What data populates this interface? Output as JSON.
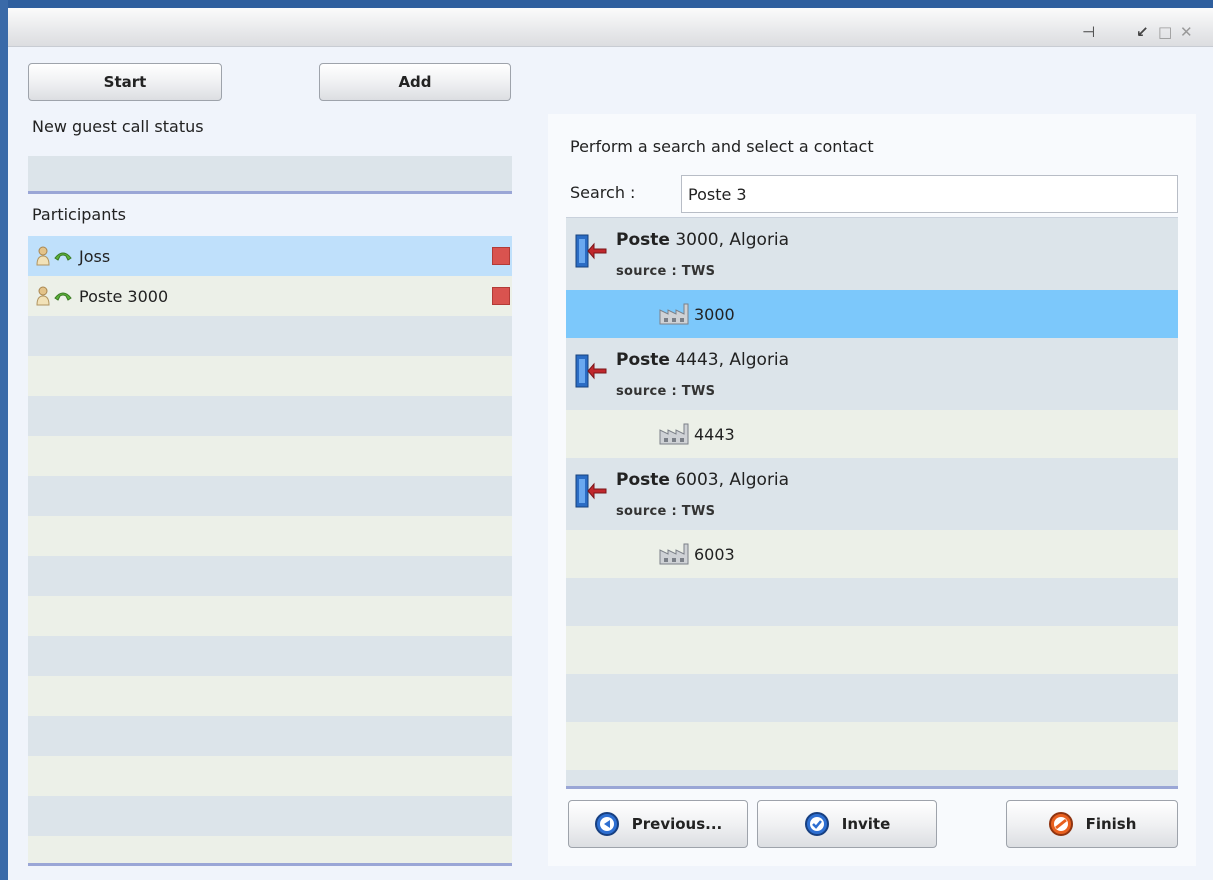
{
  "window": {
    "pin_glyph": "⊣",
    "restore_glyph": "↙",
    "maximize_glyph": "□",
    "close_glyph": "✕"
  },
  "left": {
    "start_label": "Start",
    "add_label": "Add",
    "status_label": "New guest call status",
    "status_value": "",
    "participants_label": "Participants",
    "participants": [
      {
        "name": "Joss"
      },
      {
        "name": "Poste 3000"
      }
    ]
  },
  "right": {
    "instruction": "Perform a search and select a contact",
    "search_label": "Search :",
    "search_value": "Poste 3",
    "results": [
      {
        "name_bold": "Poste",
        "name_rest": " 3000, Algoria",
        "source": "source : TWS",
        "number": "3000"
      },
      {
        "name_bold": "Poste",
        "name_rest": " 4443, Algoria",
        "source": "source : TWS",
        "number": "4443"
      },
      {
        "name_bold": "Poste",
        "name_rest": " 6003, Algoria",
        "source": "source : TWS",
        "number": "6003"
      }
    ],
    "previous_label": "Previous...",
    "invite_label": "Invite",
    "finish_label": "Finish"
  },
  "colors": {
    "selected_row": "#7cc8fb",
    "participant_selected": "#bfe0fb",
    "stop": "#d9534f",
    "frame": "#2f5f9e"
  },
  "icons": [
    "pin-icon",
    "restore-icon",
    "maximize-icon",
    "close-icon",
    "user-icon",
    "phone-icon",
    "stop-icon",
    "contact-door-icon",
    "factory-icon",
    "previous-icon",
    "invite-icon",
    "finish-icon"
  ]
}
